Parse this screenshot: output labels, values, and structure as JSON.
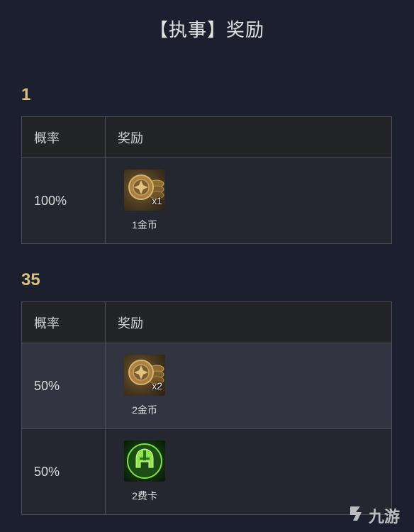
{
  "page": {
    "title": "【执事】奖励"
  },
  "sections": [
    {
      "label": "1",
      "headers": {
        "probability": "概率",
        "reward": "奖励"
      },
      "rows": [
        {
          "probability": "100%",
          "reward": {
            "icon": "coin-icon",
            "qty": "x1",
            "label": "1金币"
          }
        }
      ]
    },
    {
      "label": "35",
      "headers": {
        "probability": "概率",
        "reward": "奖励"
      },
      "rows": [
        {
          "probability": "50%",
          "reward": {
            "icon": "coin-icon",
            "qty": "x2",
            "label": "2金币"
          }
        },
        {
          "probability": "50%",
          "reward": {
            "icon": "helmet-card-icon",
            "qty": "",
            "label": "2费卡"
          }
        }
      ]
    }
  ],
  "watermark": {
    "logo": "9you-logo-icon",
    "text": "九游"
  },
  "colors": {
    "background": "#1b1f2e",
    "section_label": "#d8c07e",
    "header_bg": "#232427",
    "border": "#4b4e5a"
  }
}
